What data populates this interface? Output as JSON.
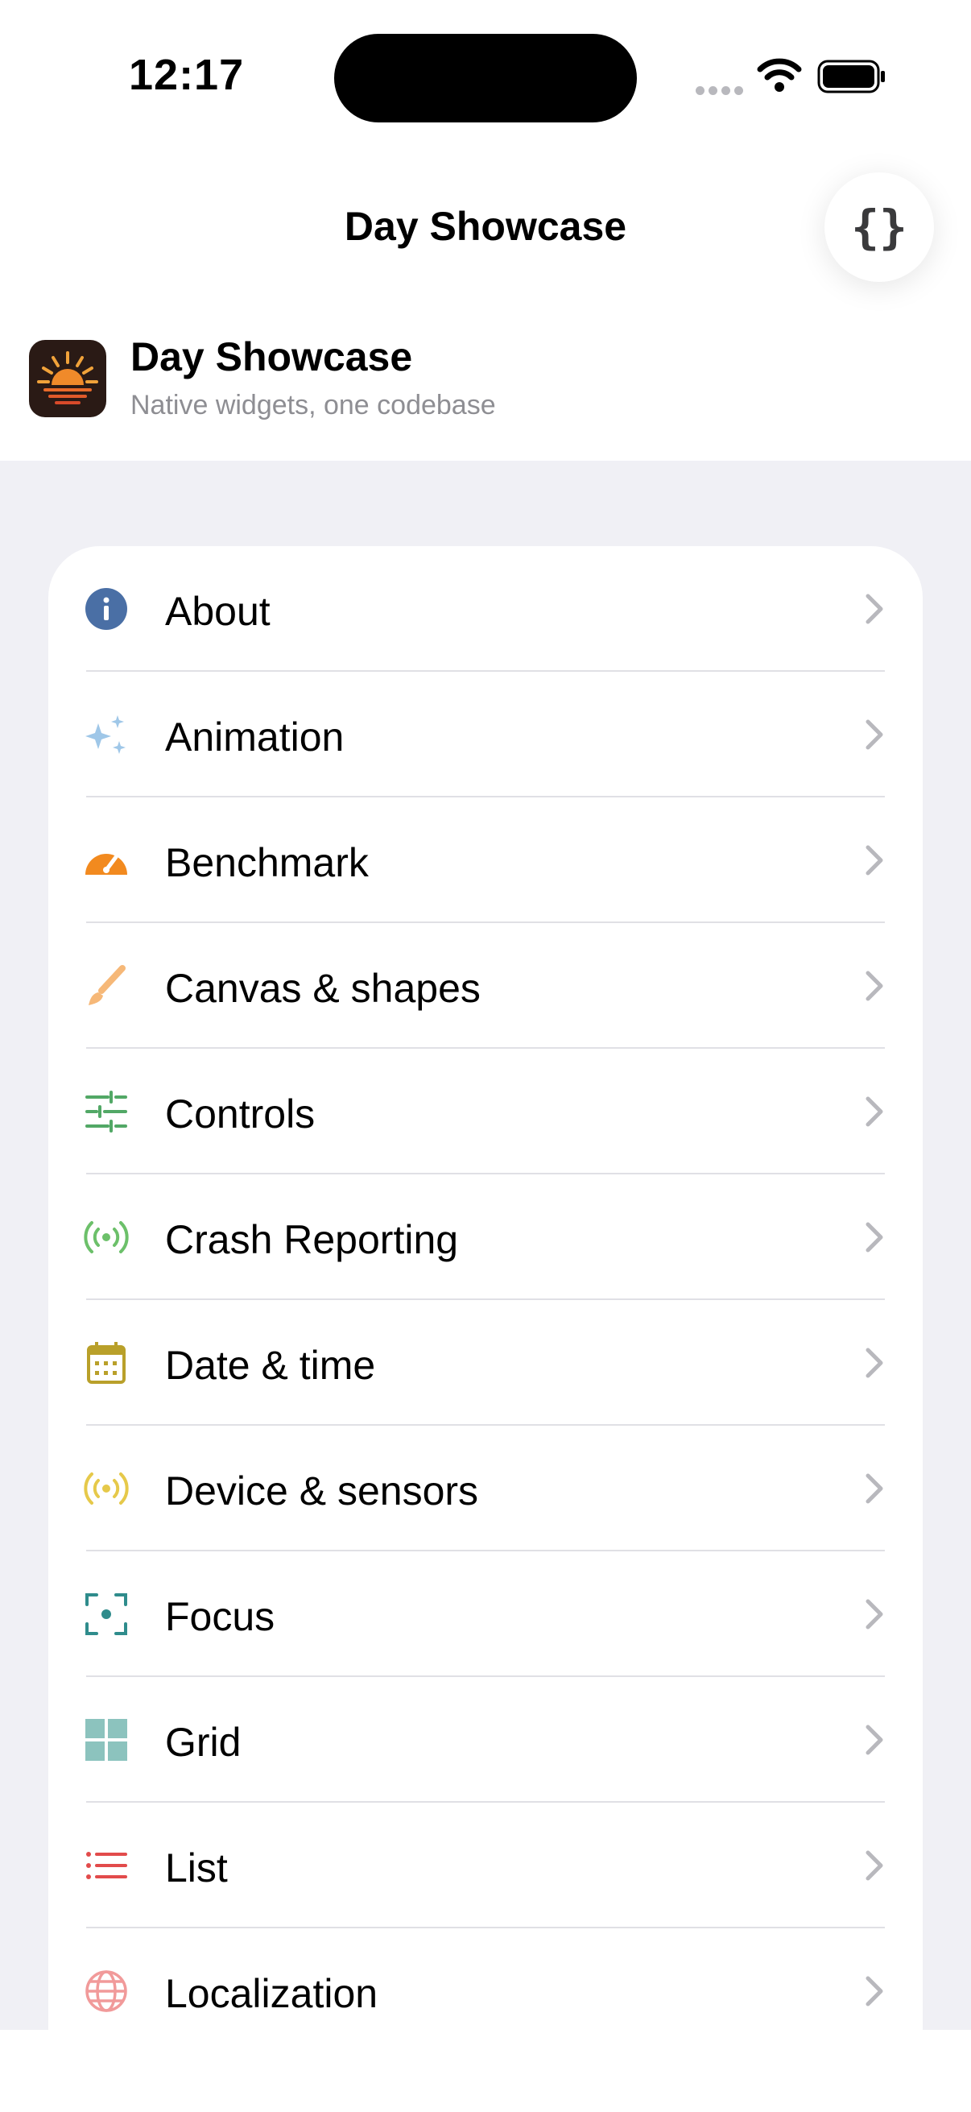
{
  "status_bar": {
    "time": "12:17"
  },
  "nav": {
    "title": "Day Showcase",
    "code_button_icon": "braces-icon"
  },
  "app": {
    "name": "Day Showcase",
    "tagline": "Native widgets, one codebase",
    "icon": "sunrise-app-icon"
  },
  "menu": [
    {
      "label": "About",
      "icon": "info-icon",
      "color": "#4a6fa5"
    },
    {
      "label": "Animation",
      "icon": "sparkles-icon",
      "color": "#9fc7e8"
    },
    {
      "label": "Benchmark",
      "icon": "gauge-icon",
      "color": "#f28a1f"
    },
    {
      "label": "Canvas & shapes",
      "icon": "brush-icon",
      "color": "#f6b878"
    },
    {
      "label": "Controls",
      "icon": "sliders-icon",
      "color": "#52a866"
    },
    {
      "label": "Crash Reporting",
      "icon": "broadcast-icon",
      "color": "#6cc06a"
    },
    {
      "label": "Date & time",
      "icon": "calendar-icon",
      "color": "#b9a02a"
    },
    {
      "label": "Device & sensors",
      "icon": "sensor-broadcast-icon",
      "color": "#e6c94a"
    },
    {
      "label": "Focus",
      "icon": "focus-icon",
      "color": "#2f8c8c"
    },
    {
      "label": "Grid",
      "icon": "grid-icon",
      "color": "#8cc3be"
    },
    {
      "label": "List",
      "icon": "list-icon",
      "color": "#e24b4b"
    },
    {
      "label": "Localization",
      "icon": "globe-icon",
      "color": "#f19a9a"
    }
  ]
}
